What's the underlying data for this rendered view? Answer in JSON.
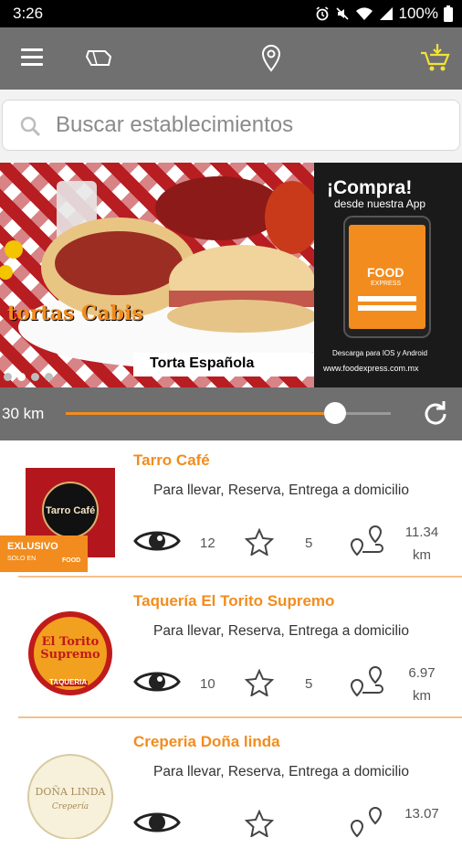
{
  "status_bar": {
    "time": "3:26",
    "battery": "100%"
  },
  "app_bar": {
    "menu_icon": "menu-icon",
    "ticket_icon": "ticket-icon",
    "location_icon": "location-pin-icon",
    "cart_icon": "cart-download-icon"
  },
  "search": {
    "placeholder": "Buscar establecimientos"
  },
  "banner": {
    "brand_text": "tortas Cabis",
    "product": "Torta Española",
    "promo_title": "¡Compra!",
    "promo_subtitle": "desde nuestra App",
    "app_name": "FOOD",
    "app_sub": "EXPRESS",
    "download_text": "Descarga para IOS y Android",
    "url": "www.foodexpress.com.mx",
    "active_slide": 1,
    "slides": 4
  },
  "distance": {
    "label": "30 km",
    "value_fraction": 0.83
  },
  "colors": {
    "accent": "#f28c1e",
    "appbar": "#707070"
  },
  "establishments": [
    {
      "name": "Tarro Café",
      "services": "Para llevar, Reserva, Entrega a domicilio",
      "views": "12",
      "rating": "5",
      "distance_value": "11.34",
      "distance_unit": "km",
      "exclusive": true,
      "badge_title": "EXLUSIVO",
      "badge_sub": "SOLO EN",
      "badge_brand": "FOOD",
      "logo_text": "Tarro Café"
    },
    {
      "name": "Taquería El Torito Supremo",
      "services": "Para llevar, Reserva, Entrega a domicilio",
      "views": "10",
      "rating": "5",
      "distance_value": "6.97",
      "distance_unit": "km",
      "exclusive": false,
      "logo_text": "El Torito Supremo",
      "logo_text2": "TAQUERIA"
    },
    {
      "name": "Creperia Doña linda",
      "services": "Para llevar, Reserva, Entrega a domicilio",
      "views": "",
      "rating": "",
      "distance_value": "13.07",
      "distance_unit": "",
      "exclusive": false,
      "logo_text": "DOÑA LINDA",
      "logo_text2": "Crepería"
    }
  ]
}
